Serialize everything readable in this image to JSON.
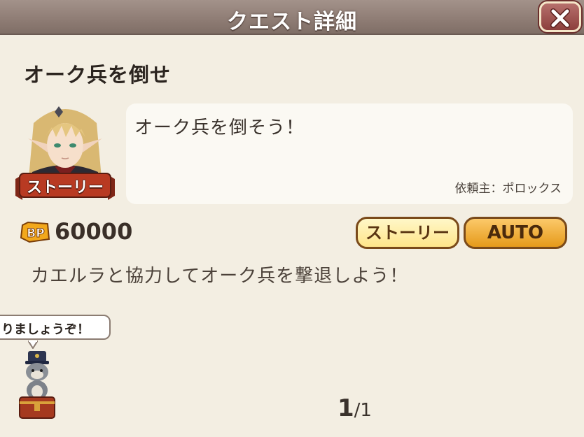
{
  "header": {
    "title": "クエスト詳細",
    "close_icon": "close-x-icon"
  },
  "quest": {
    "title": "オーク兵を倒せ",
    "portrait_badge": "ストーリー",
    "message": "オーク兵を倒そう！",
    "requester": "依頼主：ポロックス",
    "bp_icon_label": "BP",
    "bp_value": "60000",
    "description": "カエルラと協力してオーク兵を撃退しよう！"
  },
  "buttons": {
    "story_label": "ストーリー",
    "auto_label": "AUTO"
  },
  "mascot": {
    "speech": "りましょうぞ！"
  },
  "pagination": {
    "current": "1",
    "total": "/1"
  },
  "colors": {
    "title_bar": "#8e7c74",
    "background": "#f3eee2",
    "close_button": "#8c3f3c",
    "story_button": "#ffe58a",
    "auto_button": "#e59a1a",
    "ribbon": "#b83a22"
  }
}
